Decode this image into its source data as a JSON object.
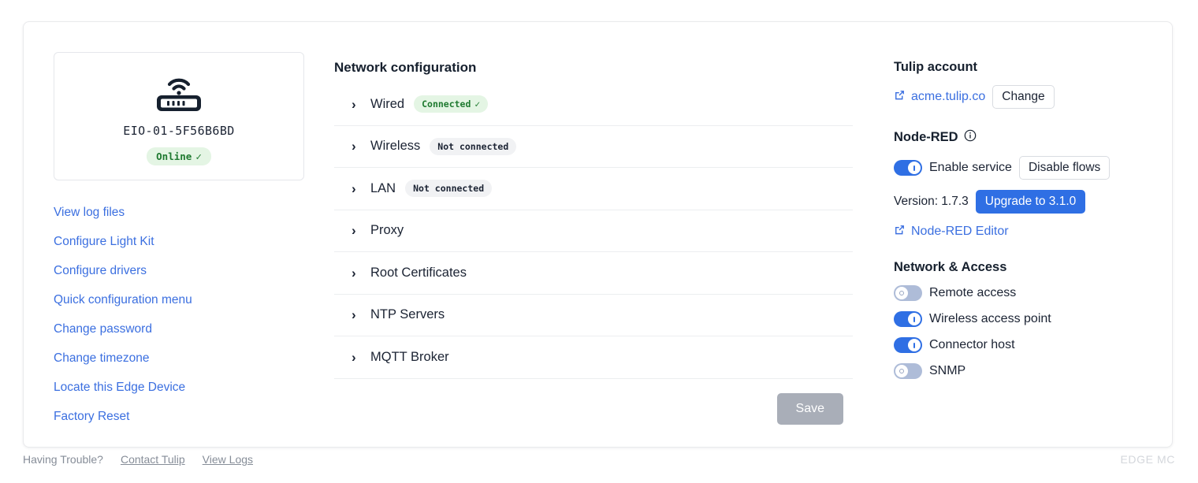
{
  "device": {
    "icon": "router-wifi-icon",
    "id": "EIO-01-5F56B6BD",
    "status_label": "Online",
    "status_check": "✓"
  },
  "sidebar": {
    "links": [
      {
        "label": "View log files"
      },
      {
        "label": "Configure Light Kit"
      },
      {
        "label": "Configure drivers"
      },
      {
        "label": "Quick configuration menu"
      },
      {
        "label": "Change password"
      },
      {
        "label": "Change timezone"
      },
      {
        "label": "Locate this Edge Device"
      },
      {
        "label": "Factory Reset"
      }
    ]
  },
  "network": {
    "title": "Network configuration",
    "rows": [
      {
        "label": "Wired",
        "badge": "Connected",
        "badge_check": "✓",
        "badge_state": "connected"
      },
      {
        "label": "Wireless",
        "badge": "Not connected",
        "badge_check": "",
        "badge_state": "notconnected"
      },
      {
        "label": "LAN",
        "badge": "Not connected",
        "badge_check": "",
        "badge_state": "notconnected"
      },
      {
        "label": "Proxy",
        "badge": "",
        "badge_check": "",
        "badge_state": "none"
      },
      {
        "label": "Root Certificates",
        "badge": "",
        "badge_check": "",
        "badge_state": "none"
      },
      {
        "label": "NTP Servers",
        "badge": "",
        "badge_check": "",
        "badge_state": "none"
      },
      {
        "label": "MQTT Broker",
        "badge": "",
        "badge_check": "",
        "badge_state": "none"
      }
    ],
    "save_label": "Save",
    "save_disabled": true
  },
  "tulip_account": {
    "title": "Tulip account",
    "link_label": "acme.tulip.co",
    "link_icon": "external-link-icon",
    "change_label": "Change"
  },
  "node_red": {
    "title": "Node-RED",
    "info_icon": "info-circle-icon",
    "enable_label": "Enable service",
    "enable_state": "on",
    "disable_flows_label": "Disable flows",
    "version_label": "Version: 1.7.3",
    "upgrade_label": "Upgrade to 3.1.0",
    "editor_link_label": "Node-RED Editor",
    "editor_link_icon": "external-link-icon"
  },
  "network_access": {
    "title": "Network & Access",
    "toggles": [
      {
        "label": "Remote access",
        "state": "off"
      },
      {
        "label": "Wireless access point",
        "state": "on"
      },
      {
        "label": "Connector host",
        "state": "on"
      },
      {
        "label": "SNMP",
        "state": "off"
      }
    ]
  },
  "footer": {
    "help_text": "Having Trouble?",
    "contact_label": "Contact Tulip",
    "logs_label": "View Logs",
    "brand": "EDGE MC"
  },
  "colors": {
    "link_blue": "#3b6fe0",
    "primary_blue": "#2f6fe4",
    "success_green": "#1f7a30",
    "success_bg": "#e4f5e4",
    "neutral_bg": "#f1f2f4",
    "disabled_grey": "#a9aeb8"
  }
}
